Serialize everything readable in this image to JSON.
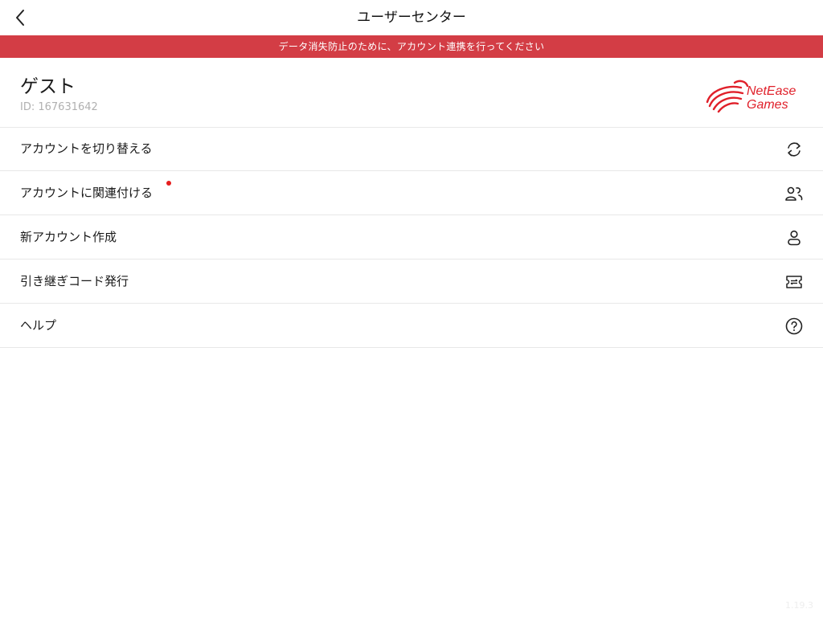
{
  "header": {
    "title": "ユーザーセンター",
    "back_icon": "chevron-left-icon"
  },
  "banner": {
    "text": "データ消失防止のために、アカウント連携を行ってください",
    "color": "#d33d45"
  },
  "profile": {
    "name": "ゲスト",
    "id_text": "ID: 167631642",
    "brand_line1": "NetEase",
    "brand_line2": "Games",
    "brand_color": "#e0202a"
  },
  "menu": {
    "items": [
      {
        "label": "アカウントを切り替える",
        "icon": "refresh-icon"
      },
      {
        "label": "アカウントに関連付ける",
        "icon": "link-users-icon",
        "badge": "red-dot"
      },
      {
        "label": "新アカウント作成",
        "icon": "user-icon"
      },
      {
        "label": "引き継ぎコード発行",
        "icon": "ticket-icon"
      },
      {
        "label": "ヘルプ",
        "icon": "help-icon"
      }
    ]
  },
  "footer": {
    "version": "1.19.3"
  }
}
